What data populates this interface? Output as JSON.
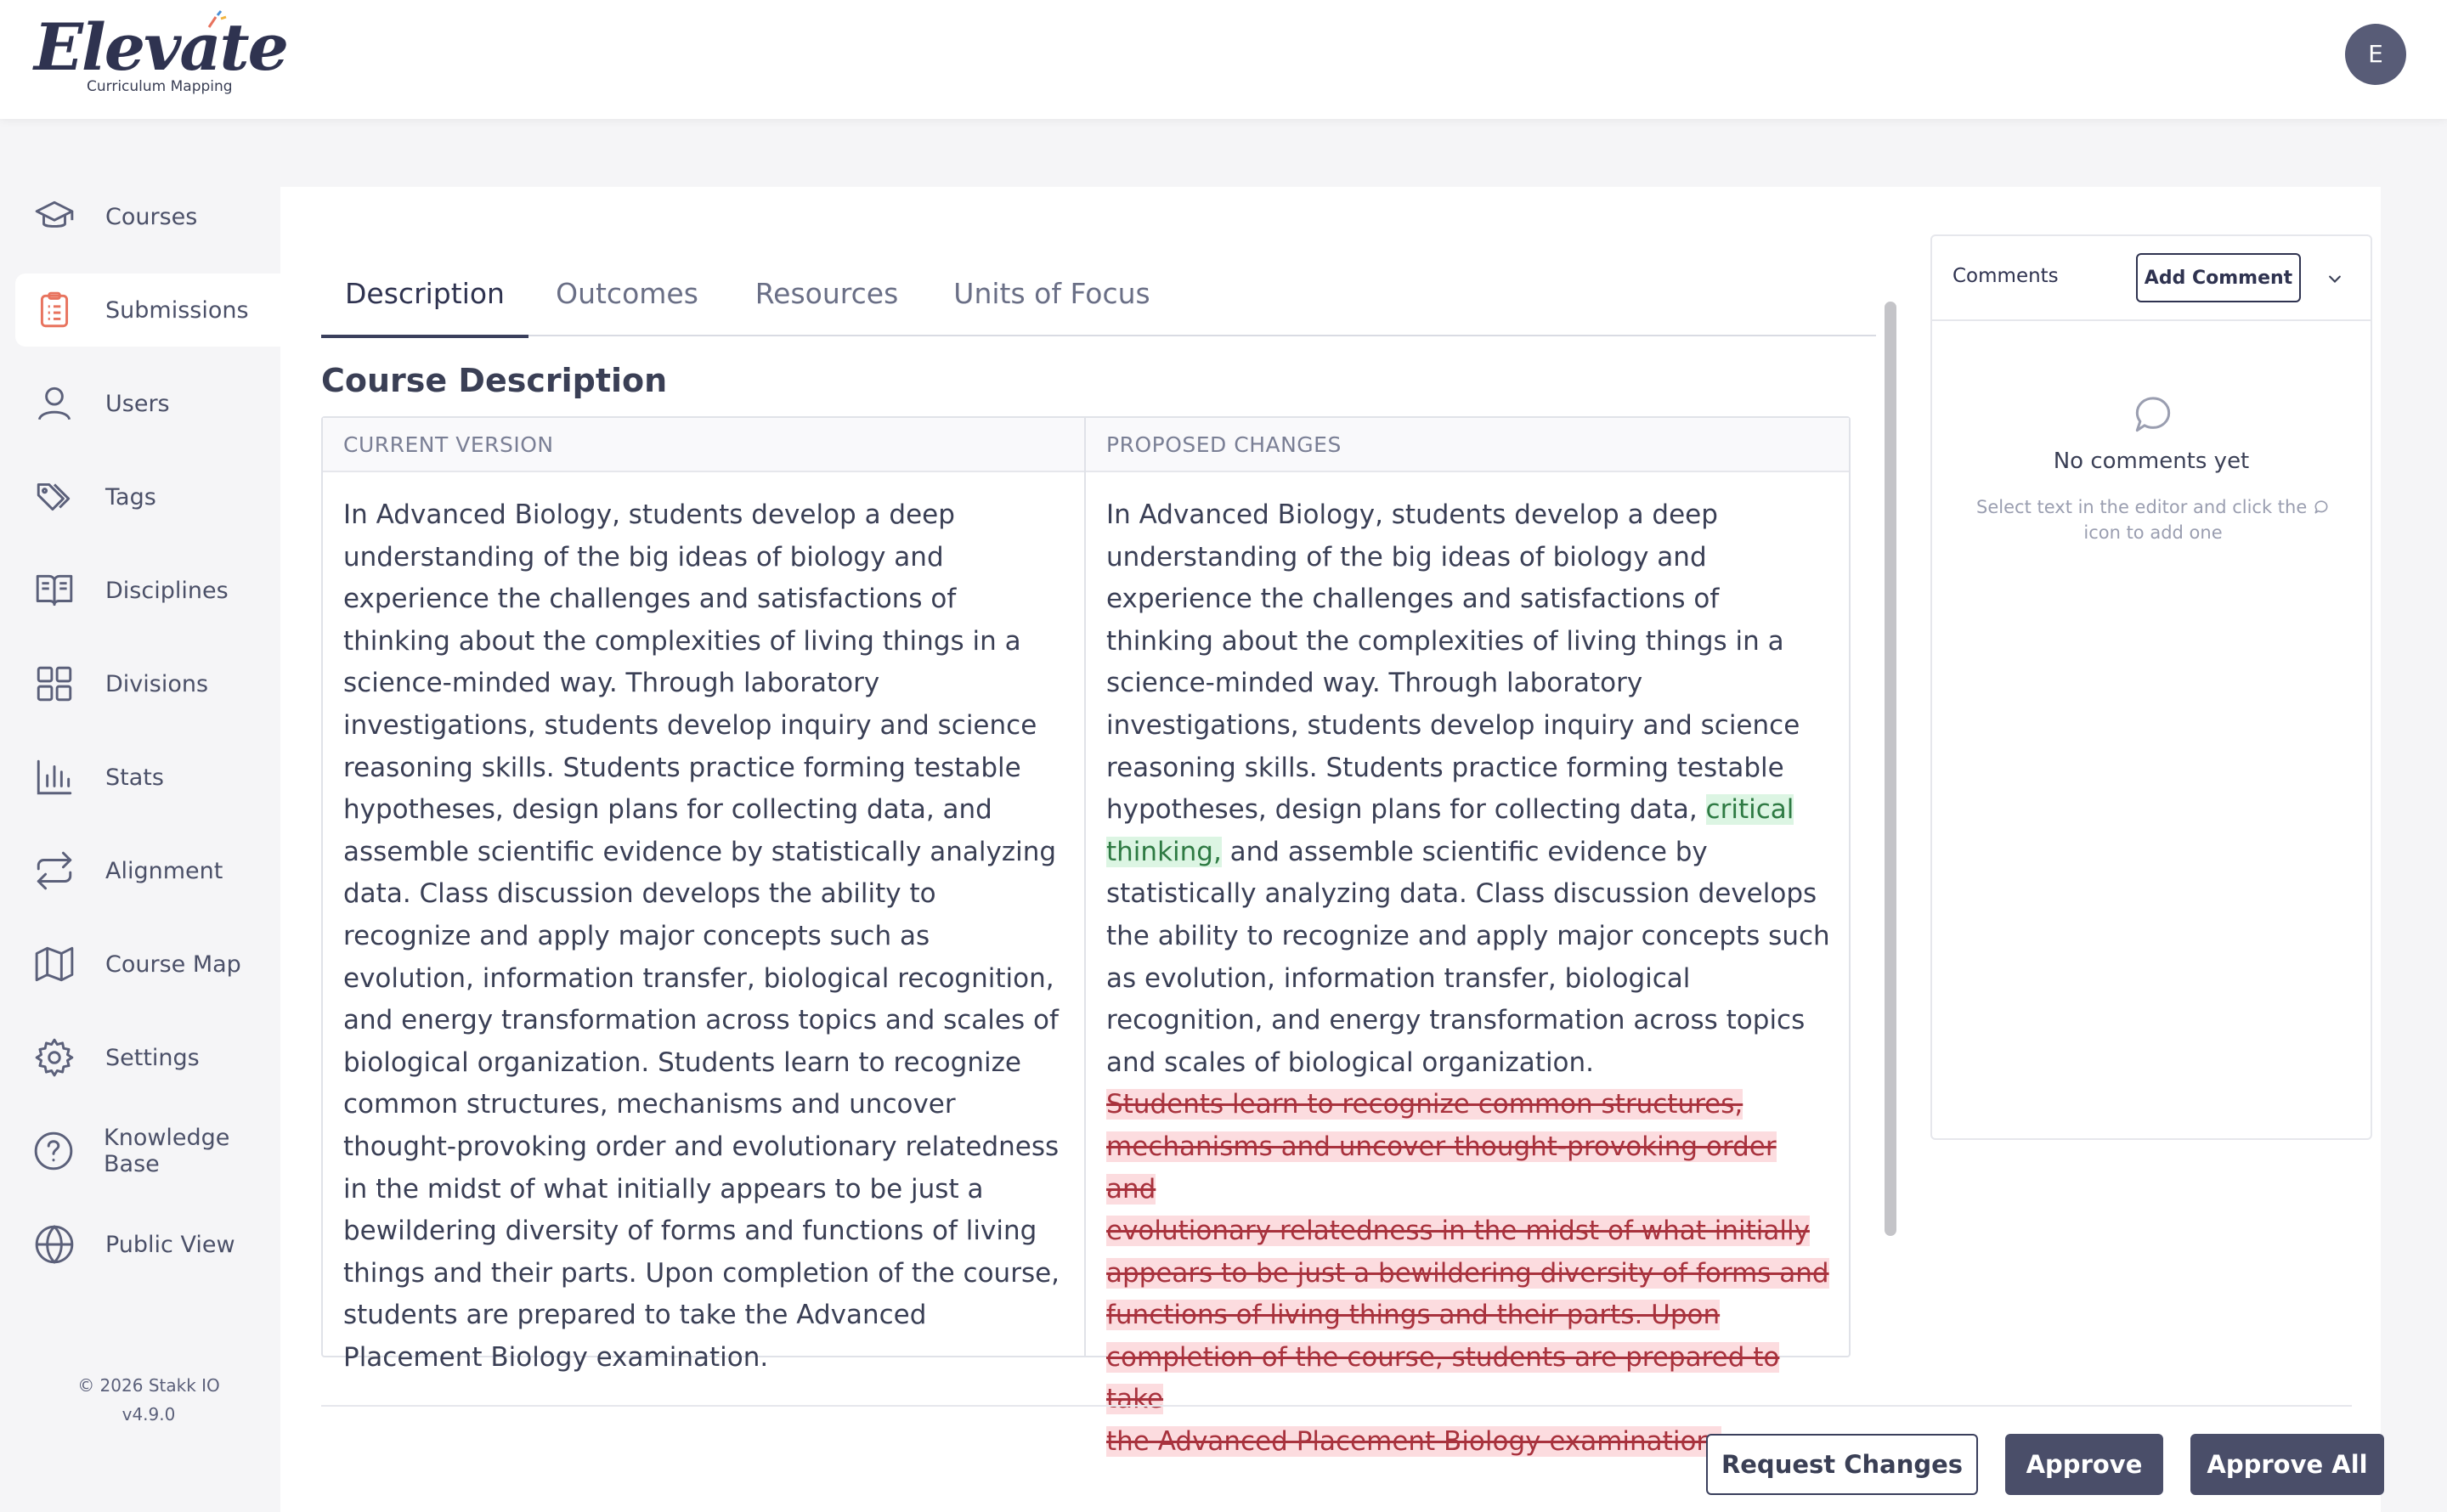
{
  "brand": {
    "name": "Elevate",
    "tagline": "Curriculum Mapping"
  },
  "user": {
    "avatar_initial": "E"
  },
  "sidebar": {
    "items": [
      {
        "label": "Courses",
        "icon": "graduation-cap-icon"
      },
      {
        "label": "Submissions",
        "icon": "clipboard-icon",
        "active": true
      },
      {
        "label": "Users",
        "icon": "user-icon"
      },
      {
        "label": "Tags",
        "icon": "tags-icon"
      },
      {
        "label": "Disciplines",
        "icon": "book-open-icon"
      },
      {
        "label": "Divisions",
        "icon": "grid-icon"
      },
      {
        "label": "Stats",
        "icon": "bar-chart-icon"
      },
      {
        "label": "Alignment",
        "icon": "repeat-icon"
      },
      {
        "label": "Course Map",
        "icon": "map-icon"
      },
      {
        "label": "Settings",
        "icon": "gear-icon"
      },
      {
        "label": "Knowledge Base",
        "icon": "help-circle-icon"
      },
      {
        "label": "Public View",
        "icon": "globe-icon"
      }
    ],
    "copyright": "© 2026 Stakk IO",
    "version": "v4.9.0"
  },
  "tabs": [
    {
      "label": "Description",
      "active": true
    },
    {
      "label": "Outcomes"
    },
    {
      "label": "Resources"
    },
    {
      "label": "Units of Focus"
    }
  ],
  "section_title": "Course Description",
  "diff": {
    "current_header": "CURRENT VERSION",
    "proposed_header": "PROPOSED CHANGES",
    "current_text": "In Advanced Biology, students develop a deep understanding of the big ideas of biology and experience the challenges and satisfactions of thinking about the complexities of living things in a science-minded way. Through laboratory investigations, students develop inquiry and science reasoning skills. Students practice forming testable hypotheses, design plans for collecting data, and assemble scientific evidence by statistically analyzing data. Class discussion develops the ability to recognize and apply major concepts such as evolution, information transfer, biological recognition, and energy transformation across topics and scales of biological organization. Students learn to recognize common structures, mechanisms and uncover thought-provoking order and evolutionary relatedness in the midst of what initially appears to be just a bewildering diversity of forms and functions of living things and their parts. Upon completion of the course, students are prepared to take the Advanced Placement Biology examination.",
    "proposed_before_insert": "In Advanced Biology, students develop a deep understanding of the big ideas of biology and experience the challenges and satisfactions of thinking about the complexities of living things in a science-minded way. Through laboratory investigations, students develop inquiry and science reasoning skills. Students practice forming testable hypotheses, design plans for collecting data, ",
    "proposed_insert": "critical thinking,",
    "proposed_after_insert": " and assemble scientific evidence by statistically analyzing data. Class discussion develops the ability to recognize and apply major concepts such as evolution, information transfer, biological recognition, and energy transformation across topics and scales of biological organization.",
    "proposed_deleted_lines": [
      "Students learn to recognize common structures,",
      "mechanisms and uncover thought-provoking order and",
      "evolutionary relatedness in the midst of what initially",
      "appears to be just a bewildering diversity of forms and",
      "functions of living things and their parts. Upon",
      "completion of the course, students are prepared to take",
      "the Advanced Placement Biology examination."
    ],
    "insert_color": "#dcf5e3",
    "delete_color": "#fcdcdf"
  },
  "comments": {
    "title": "Comments",
    "add_label": "Add Comment",
    "empty_title": "No comments yet",
    "hint_before_icon": "Select text in the editor and click the",
    "hint_after_icon": "icon to add one"
  },
  "actions": {
    "request_changes": "Request Changes",
    "approve": "Approve",
    "approve_all": "Approve All"
  },
  "colors": {
    "primary_dark": "#4a4e69",
    "active_icon": "#e8735e",
    "icon_gray": "#5b607a"
  }
}
